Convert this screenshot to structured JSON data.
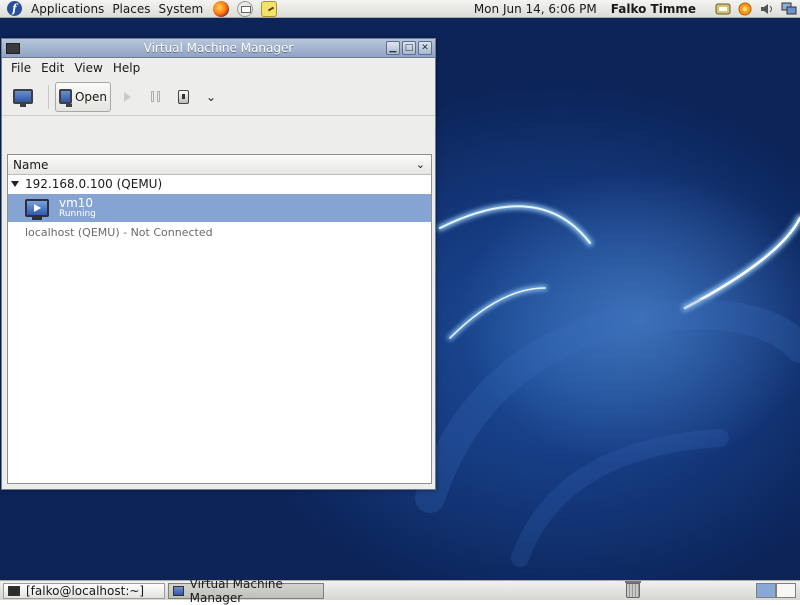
{
  "top_panel": {
    "menus": [
      "Applications",
      "Places",
      "System"
    ],
    "launchers": [
      "firefox-icon",
      "mail-icon",
      "notes-icon"
    ],
    "clock": "Mon Jun 14,  6:06 PM",
    "user": "Falko Timme",
    "tray_icons": [
      "network-icon",
      "updates-icon",
      "volume-icon",
      "network-manager-icon"
    ]
  },
  "window": {
    "title": "Virtual Machine Manager",
    "menubar": [
      "File",
      "Edit",
      "View",
      "Help"
    ],
    "toolbar": {
      "open_label": "Open"
    },
    "list": {
      "column_header": "Name",
      "host": "192.168.0.100 (QEMU)",
      "vm": {
        "name": "vm10",
        "status": "Running"
      },
      "localhost": "localhost (QEMU) - Not Connected"
    }
  },
  "bottom_panel": {
    "tasks": [
      "[falko@localhost:~]",
      "Virtual Machine Manager"
    ]
  },
  "colors": {
    "selection": "#86a4d3",
    "titlebar": "#8fa3c3",
    "desktop": "#14387c"
  }
}
